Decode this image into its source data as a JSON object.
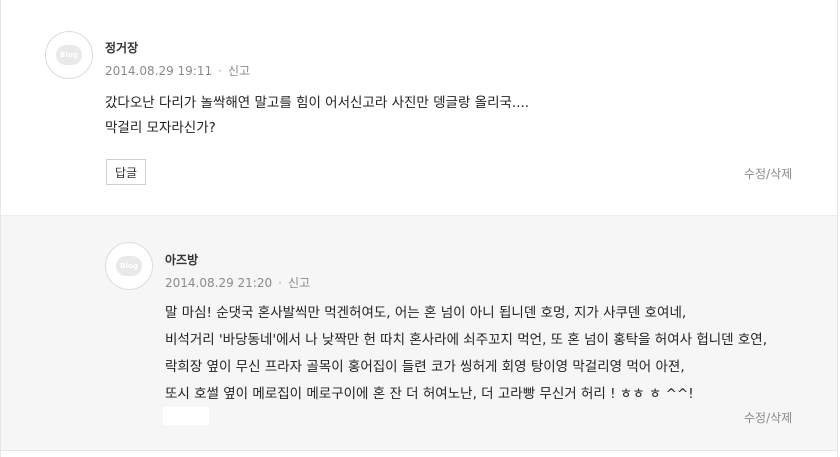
{
  "comments": [
    {
      "author": "정거장",
      "avatar_text": "Blog",
      "date": "2014.08.29 19:11",
      "separator": "·",
      "report_label": "신고",
      "lines": [
        "갔다오난 다리가 놀싹해연 말고를 힘이 어서신고라 사진만 뎅글랑 올리국....",
        "막걸리 모자라신가?"
      ],
      "reply_label": "답글",
      "edit_label": "수정/삭제"
    },
    {
      "author": "아즈방",
      "avatar_text": "Blog",
      "date": "2014.08.29 21:20",
      "separator": "·",
      "report_label": "신고",
      "lines": [
        "말 마심! 순댓국 혼사발씩만 먹겐허여도, 어는 혼 넘이 아니 됩니덴 호멍, 지가 사쿠덴  호여네,",
        "비석거리 '바당동네'에서 나 낮짝만 헌 따치 혼사라에 쇠주꼬지 먹언, 또 혼 넘이 홍탁을  허여사 헙니덴 호연,",
        "락희장 옆이 무신 프라자 골목이 홍어집이 들련 코가 씽허게 회영 탕이영 막걸리영 먹어 아젼,",
        "또시 호썰 옆이 메로집이 메로구이에 혼 잔 더 허여노난, 더 고라빵 무신거 허리 ! ㅎㅎ ㅎ ^^!"
      ],
      "edit_label": "수정/삭제"
    }
  ]
}
